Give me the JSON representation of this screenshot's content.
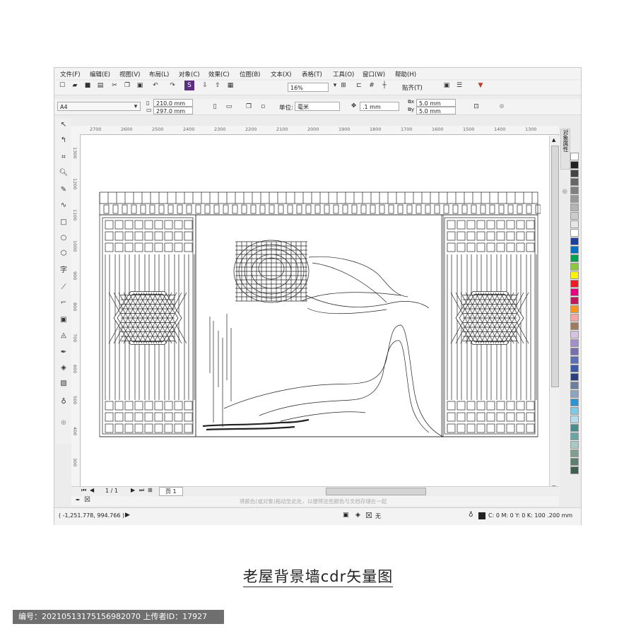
{
  "menu": [
    "文件(F)",
    "编辑(E)",
    "视图(V)",
    "布局(L)",
    "对象(C)",
    "效果(C)",
    "位图(B)",
    "文本(X)",
    "表格(T)",
    "工具(O)",
    "窗口(W)",
    "帮助(H)"
  ],
  "toolbar": {
    "zoom": "16%",
    "snap_label": "贴齐(T)"
  },
  "propbar": {
    "page_size": "A4",
    "width": "210.0 mm",
    "height": "297.0 mm",
    "units_label": "单位:",
    "units_value": "毫米",
    "nudge": ".1 mm",
    "dup_x": "5.0 mm",
    "dup_y": "5.0 mm"
  },
  "ruler_h": [
    "2700",
    "2600",
    "2500",
    "2400",
    "2300",
    "2200",
    "2100",
    "2000",
    "1900",
    "1800",
    "1700",
    "1600",
    "1500",
    "1400",
    "1300"
  ],
  "ruler_v": [
    "1300",
    "1200",
    "1100",
    "1000",
    "900",
    "800",
    "700",
    "600",
    "500",
    "400",
    "300"
  ],
  "docker_tab": "对象属性",
  "page_nav": {
    "counter": "1 / 1",
    "page_tab": "页 1"
  },
  "color_hint": "将颜色(或对象)拖动至此处，以便将这些颜色与文档存储在一起",
  "status": {
    "coords": "( -1,251.778, 994.766 )",
    "fill_none": "无",
    "outline_info": "C: 0 M: 0 Y: 0 K: 100 .200 mm"
  },
  "palette": [
    "#ffffff",
    "#222222",
    "#444444",
    "#666666",
    "#808080",
    "#999999",
    "#b3b3b3",
    "#cccccc",
    "#e6e6e6",
    "#ffffff",
    "#1e3f9a",
    "#0070c0",
    "#00a050",
    "#8dc63f",
    "#fff200",
    "#ed1c24",
    "#e4007f",
    "#c2185b",
    "#f7941d",
    "#f4a6a6",
    "#9e7b5e",
    "#d4c4e0",
    "#a38fc8",
    "#7a6db0",
    "#5b6fb5",
    "#3d5aa8",
    "#2b3f80",
    "#6d7f9e",
    "#8ea3bf",
    "#2e93d1",
    "#7ec8e3",
    "#b7dce9",
    "#4a8c8c",
    "#6aa6a6",
    "#a8c8c8",
    "#7f9f8f",
    "#5f7f6f",
    "#3f5f4f"
  ],
  "caption": "老屋背景墙cdr矢量图",
  "footer": "编号：20210513175156982070 上传者ID：17927"
}
